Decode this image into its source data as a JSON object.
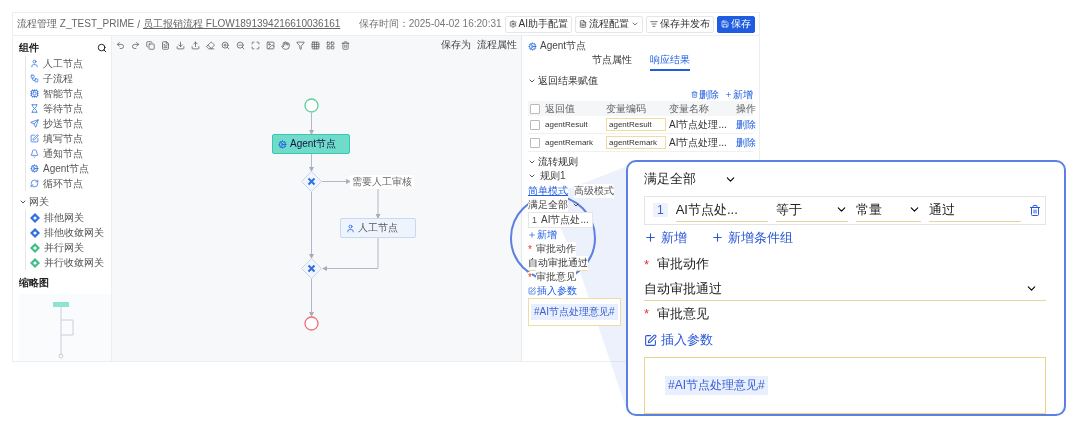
{
  "breadcrumb": {
    "items": [
      "流程管理 Z_TEST_PRIME",
      "员工报销流程 FLOW1891394216610036161"
    ],
    "separator": "/"
  },
  "header": {
    "saved_time": "保存时间：2025-04-02 16:20:31",
    "buttons": [
      {
        "label": "AI助手配置",
        "kind": "assistant"
      },
      {
        "label": "流程配置",
        "kind": "dropdown"
      },
      {
        "label": "保存并发布",
        "kind": "publish"
      },
      {
        "label": "保存",
        "kind": "primary"
      }
    ]
  },
  "toolbar": {
    "save_as": "保存为",
    "flow_props": "流程属性"
  },
  "sidebar": {
    "title": "组件",
    "items": [
      {
        "label": "人工节点",
        "kind": "user"
      },
      {
        "label": "子流程",
        "kind": "subflow"
      },
      {
        "label": "智能节点",
        "kind": "smart"
      },
      {
        "label": "等待节点",
        "kind": "wait"
      },
      {
        "label": "抄送节点",
        "kind": "cc"
      },
      {
        "label": "填写节点",
        "kind": "fill"
      },
      {
        "label": "通知节点",
        "kind": "notify"
      },
      {
        "label": "Agent节点",
        "kind": "agent"
      },
      {
        "label": "循环节点",
        "kind": "loop"
      }
    ],
    "gateways": {
      "label": "网关",
      "expanded": true,
      "items": [
        {
          "label": "排他网关",
          "kind": "exclusive"
        },
        {
          "label": "排他收敛网关",
          "kind": "exclusive"
        },
        {
          "label": "并行网关",
          "kind": "parallel"
        },
        {
          "label": "并行收敛网关",
          "kind": "parallel"
        }
      ]
    },
    "minimap_title": "缩略图"
  },
  "canvas": {
    "nodes": [
      {
        "kind": "start"
      },
      {
        "kind": "agent",
        "label": "Agent节点",
        "selected": true
      },
      {
        "kind": "gateway"
      },
      {
        "kind": "user",
        "label": "人工节点",
        "selected": false
      },
      {
        "kind": "merge"
      },
      {
        "kind": "end"
      }
    ],
    "edge_label": "需要人工审核"
  },
  "panel": {
    "title": "Agent节点",
    "tabs": [
      {
        "label": "节点属性",
        "selected": false
      },
      {
        "label": "响应结果",
        "selected": true
      }
    ],
    "result": {
      "title": "返回结果赋值",
      "expanded": true,
      "all_checked": false,
      "actions": [
        "删除",
        "新增"
      ],
      "columns": [
        "返回值",
        "变量编码",
        "变量名称",
        "操作"
      ],
      "rows": [
        {
          "checked": false,
          "value": "agentResult",
          "code": "agentResult",
          "name": "AI节点处理...",
          "action": "删除"
        },
        {
          "checked": false,
          "value": "agentRemark",
          "code": "agentRemark",
          "name": "AI节点处理...",
          "action": "删除"
        }
      ]
    },
    "rules": {
      "title": "流转规则",
      "expanded": true,
      "rule_title": "规则1",
      "modes": [
        {
          "label": "简单模式",
          "selected": true
        },
        {
          "label": "高级模式",
          "selected": false
        }
      ],
      "match": "满足全部",
      "index": "1",
      "field": "AI节点处...",
      "add": "新增",
      "required_mark": "*",
      "action_label": "审批动作",
      "action_value": "自动审批通过",
      "opinion_label": "审批意见",
      "insert": "插入参数",
      "opinion_value": "#AI节点处理意见#"
    }
  },
  "callout": {
    "match": "满足全部",
    "index": "1",
    "field": "AI节点处...",
    "operator": "等于",
    "value_type": "常量",
    "value": "通过",
    "add": "新增",
    "add_group": "新增条件组",
    "required_mark": "*",
    "action_label": "审批动作",
    "action_value": "自动审批通过",
    "opinion_label": "审批意见",
    "insert": "插入参数",
    "opinion_value": "#AI节点处理意见#"
  }
}
